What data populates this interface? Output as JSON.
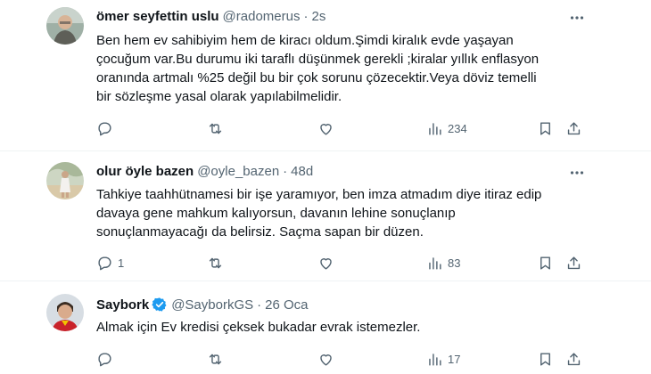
{
  "colors": {
    "text": "#0f1419",
    "muted": "#536471",
    "verified": "#1d9bf0",
    "divider": "#eff3f4"
  },
  "tweets": [
    {
      "name": "ömer seyfettin uslu",
      "handle": "@radomerus",
      "time": "2s",
      "verified": false,
      "lines": [
        "Ben hem ev sahibiyim hem de kiracı oldum.Şimdi kiralık evde yaşayan",
        "çocuğum var.Bu durumu iki taraflı düşünmek gerekli ;kiralar yıllık enflasyon",
        "oranında artmalı %25 değil bu bir çok sorunu çözecektir.Veya döviz temelli",
        "bir sözleşme yasal olarak yapılabilmelidir."
      ],
      "replies": "",
      "retweets": "",
      "likes": "",
      "views": "234"
    },
    {
      "name": "olur öyle bazen",
      "handle": "@oyle_bazen",
      "time": "48d",
      "verified": false,
      "lines": [
        "Tahkiye taahhütnamesi bir işe yaramıyor, ben imza atmadım diye itiraz edip",
        "davaya gene mahkum kalıyorsun, davanın lehine sonuçlanıp",
        "sonuçlanmayacağı da belirsiz. Saçma sapan bir düzen."
      ],
      "replies": "1",
      "retweets": "",
      "likes": "",
      "views": "83"
    },
    {
      "name": "Sayb​ork",
      "handle": "@SayborkGS",
      "time": "26 Oca",
      "verified": true,
      "lines": [
        "Almak için Ev kredisi çeksek bukadar evrak istemezler."
      ],
      "replies": "",
      "retweets": "",
      "likes": "",
      "views": "17"
    }
  ],
  "icons": [
    "more-icon",
    "reply-icon",
    "retweet-icon",
    "like-icon",
    "views-icon",
    "bookmark-icon",
    "share-icon",
    "verified-badge-icon"
  ]
}
